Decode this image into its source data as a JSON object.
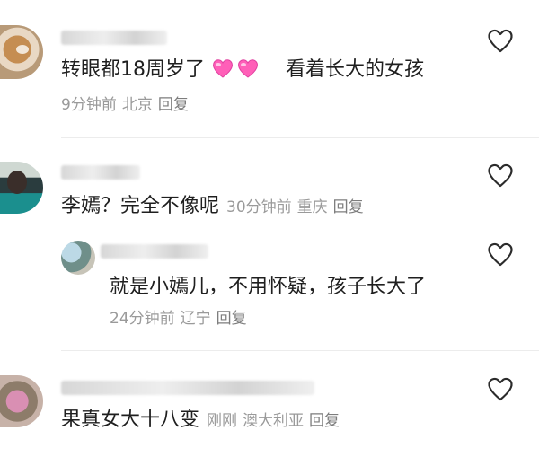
{
  "comments": [
    {
      "text": "转眼都18周岁了",
      "text_tail": "看着长大的女孩",
      "emojis": [
        "pink-heart",
        "pink-heart"
      ],
      "time": "9分钟前",
      "location": "北京",
      "reply_label": "回复"
    },
    {
      "text": "李嫣？完全不像呢",
      "time": "30分钟前",
      "location": "重庆",
      "reply_label": "回复"
    },
    {
      "text": "就是小嫣儿，不用怀疑，孩子长大了",
      "time": "24分钟前",
      "location": "辽宁",
      "reply_label": "回复",
      "is_reply": true
    },
    {
      "text": "果真女大十八变",
      "time": "刚刚",
      "location": "澳大利亚",
      "reply_label": "回复"
    }
  ],
  "colors": {
    "meta_gray": "#9a9a9a",
    "text": "#1f1f1f",
    "heart_emoji": "#ff5fb8"
  },
  "icons": {
    "like": "heart-outline-icon"
  }
}
